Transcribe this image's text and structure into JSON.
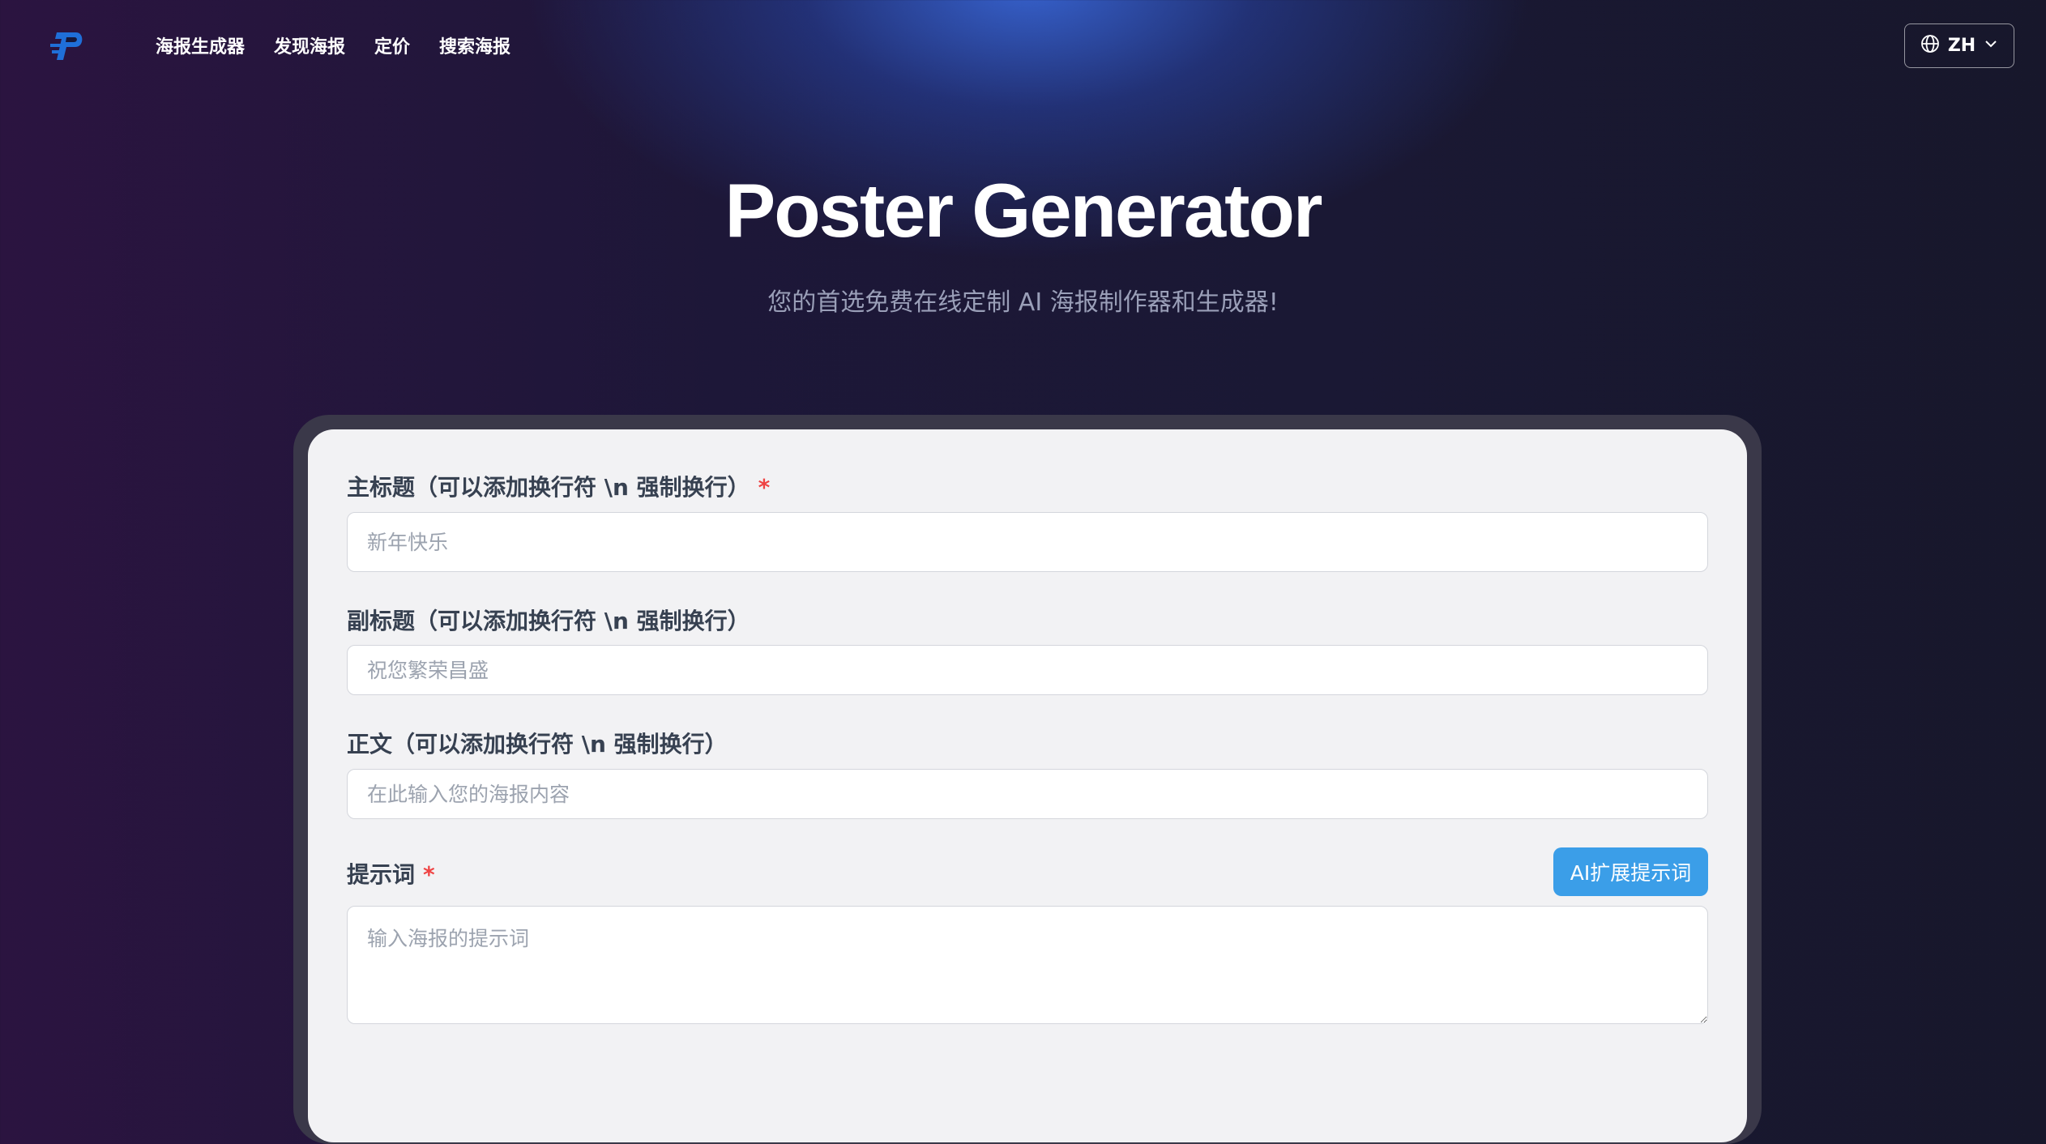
{
  "nav": {
    "logo_icon": "poster-p-logo-icon",
    "links": [
      {
        "label": "海报生成器"
      },
      {
        "label": "发现海报"
      },
      {
        "label": "定价"
      },
      {
        "label": "搜索海报"
      }
    ],
    "language": {
      "icon": "globe-icon",
      "label": "ZH",
      "chevron": "chevron-down-icon"
    }
  },
  "hero": {
    "title": "Poster Generator",
    "subtitle": "您的首选免费在线定制 AI 海报制作器和生成器!"
  },
  "form": {
    "main_title": {
      "label": "主标题（可以添加换行符 \\n 强制换行）",
      "required_mark": "*",
      "placeholder": "新年快乐",
      "value": ""
    },
    "subtitle": {
      "label": "副标题（可以添加换行符 \\n 强制换行）",
      "placeholder": "祝您繁荣昌盛",
      "value": ""
    },
    "body": {
      "label": "正文（可以添加换行符 \\n 强制换行）",
      "placeholder": "在此输入您的海报内容",
      "value": ""
    },
    "prompt": {
      "label": "提示词",
      "required_mark": "*",
      "placeholder": "输入海报的提示词",
      "value": "",
      "ai_button_label": "AI扩展提示词"
    }
  },
  "colors": {
    "accent_button": "#3b9ee8",
    "required": "#ef4444",
    "logo": "#1f6fd8"
  }
}
